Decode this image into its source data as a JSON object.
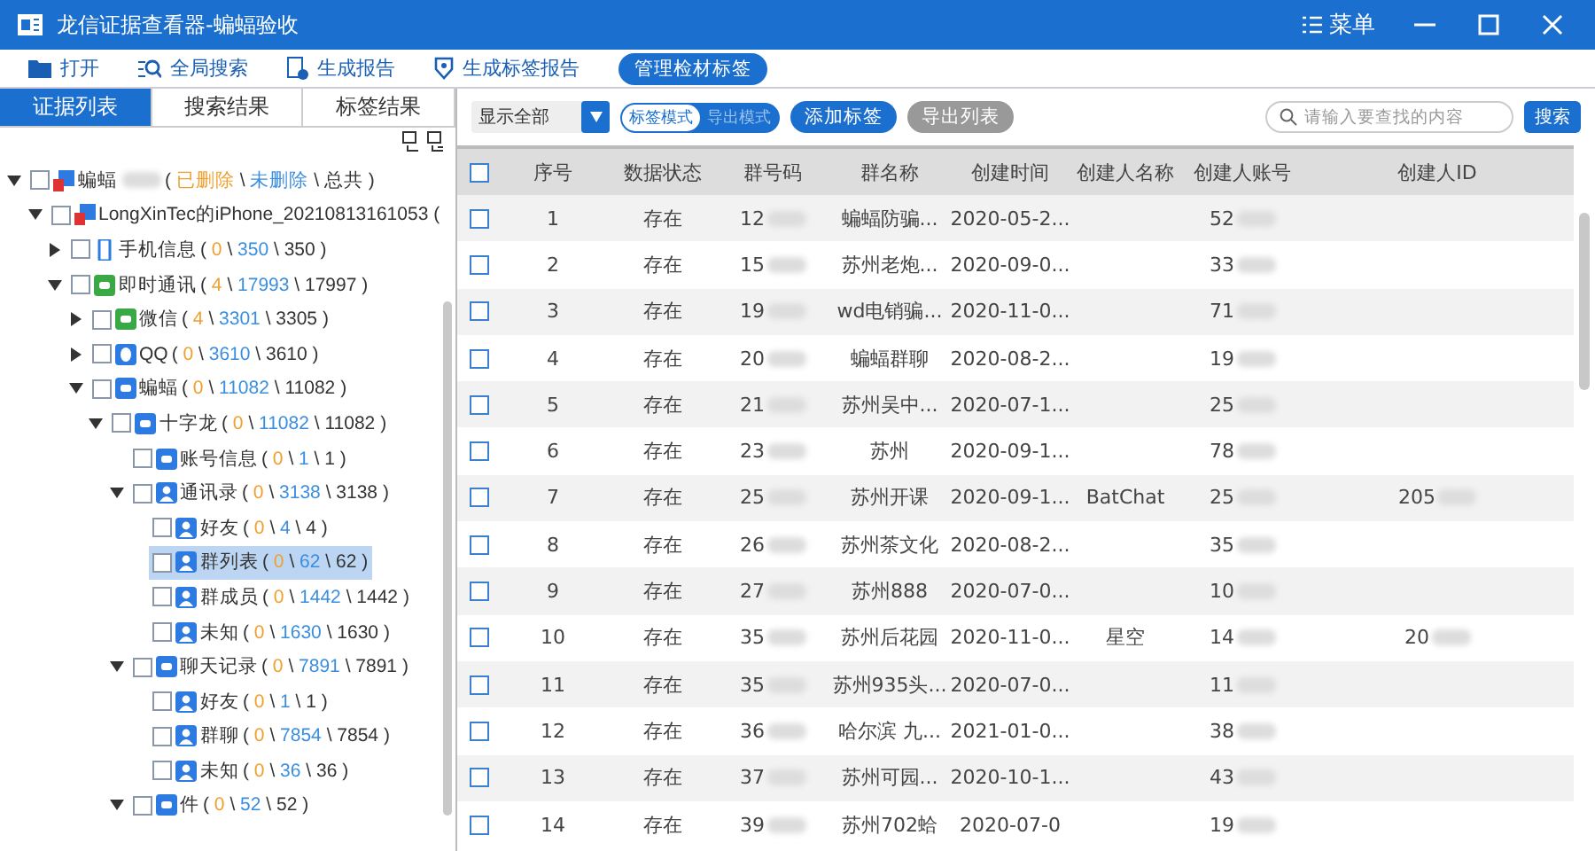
{
  "window": {
    "title": "龙信证据查看器-蝙蝠验收",
    "menu_label": "菜单"
  },
  "toolbar": [
    {
      "label": "打开",
      "kind": "folder"
    },
    {
      "label": "全局搜索",
      "kind": "search"
    },
    {
      "label": "生成报告",
      "kind": "report"
    },
    {
      "label": "生成标签报告",
      "kind": "tag"
    },
    {
      "label": "管理检材标签",
      "kind": "pill"
    }
  ],
  "count_format": {
    "open": "(",
    "sep": "\\",
    "close": ")"
  },
  "left_tabs": [
    {
      "label": "证据列表",
      "selected": true
    },
    {
      "label": "搜索结果",
      "selected": false
    },
    {
      "label": "标签结果",
      "selected": false
    }
  ],
  "tree": [
    {
      "label": "蝙蝠",
      "kind": "device",
      "blurred": true,
      "expanded": true,
      "checked": false,
      "selected": false,
      "deleted": "已删除",
      "undeleted": "未删除",
      "total": "总共",
      "children": [
        {
          "label": "LongXinTec的iPhone_20210813161053 (",
          "kind": "device",
          "expanded": true,
          "checked": false,
          "selected": false,
          "children": [
            {
              "label": "手机信息",
              "kind": "phone",
              "expanded": false,
              "checked": false,
              "selected": false,
              "deleted": "0",
              "undeleted": "350",
              "total": "350"
            },
            {
              "label": "即时通讯",
              "kind": "im",
              "expanded": true,
              "checked": false,
              "selected": false,
              "deleted": "4",
              "undeleted": "17993",
              "total": "17997",
              "children": [
                {
                  "label": "微信",
                  "kind": "wechat",
                  "expanded": false,
                  "checked": false,
                  "selected": false,
                  "deleted": "4",
                  "undeleted": "3301",
                  "total": "3305"
                },
                {
                  "label": "QQ",
                  "kind": "qq",
                  "expanded": false,
                  "checked": false,
                  "selected": false,
                  "deleted": "0",
                  "undeleted": "3610",
                  "total": "3610"
                },
                {
                  "label": "蝙蝠",
                  "kind": "app",
                  "expanded": true,
                  "checked": false,
                  "selected": false,
                  "deleted": "0",
                  "undeleted": "11082",
                  "total": "11082",
                  "children": [
                    {
                      "label": "十字龙",
                      "kind": "app",
                      "expanded": true,
                      "checked": false,
                      "selected": false,
                      "deleted": "0",
                      "undeleted": "11082",
                      "total": "11082",
                      "children": [
                        {
                          "label": "账号信息",
                          "kind": "app",
                          "checked": false,
                          "selected": false,
                          "deleted": "0",
                          "undeleted": "1",
                          "total": "1"
                        },
                        {
                          "label": "通讯录",
                          "kind": "contact",
                          "expanded": true,
                          "checked": false,
                          "selected": false,
                          "deleted": "0",
                          "undeleted": "3138",
                          "total": "3138",
                          "children": [
                            {
                              "label": "好友",
                              "kind": "contact",
                              "checked": false,
                              "selected": false,
                              "deleted": "0",
                              "undeleted": "4",
                              "total": "4"
                            },
                            {
                              "label": "群列表",
                              "kind": "contact",
                              "checked": false,
                              "selected": true,
                              "deleted": "0",
                              "undeleted": "62",
                              "total": "62"
                            },
                            {
                              "label": "群成员",
                              "kind": "contact",
                              "checked": false,
                              "selected": false,
                              "deleted": "0",
                              "undeleted": "1442",
                              "total": "1442"
                            },
                            {
                              "label": "未知",
                              "kind": "contact",
                              "checked": false,
                              "selected": false,
                              "deleted": "0",
                              "undeleted": "1630",
                              "total": "1630"
                            }
                          ]
                        },
                        {
                          "label": "聊天记录",
                          "kind": "chat",
                          "expanded": true,
                          "checked": false,
                          "selected": false,
                          "deleted": "0",
                          "undeleted": "7891",
                          "total": "7891",
                          "children": [
                            {
                              "label": "好友",
                              "kind": "contact",
                              "checked": false,
                              "selected": false,
                              "deleted": "0",
                              "undeleted": "1",
                              "total": "1"
                            },
                            {
                              "label": "群聊",
                              "kind": "contact",
                              "checked": false,
                              "selected": false,
                              "deleted": "0",
                              "undeleted": "7854",
                              "total": "7854"
                            },
                            {
                              "label": "未知",
                              "kind": "contact",
                              "checked": false,
                              "selected": false,
                              "deleted": "0",
                              "undeleted": "36",
                              "total": "36"
                            }
                          ]
                        },
                        {
                          "label": "件",
                          "kind": "chat",
                          "expanded": true,
                          "checked": false,
                          "selected": false,
                          "deleted": "0",
                          "undeleted": "52",
                          "total": "52"
                        }
                      ]
                    }
                  ]
                }
              ]
            }
          ]
        }
      ]
    }
  ],
  "filter": {
    "dropdown": "显示全部",
    "modes": [
      {
        "label": "标签模式",
        "selected": true
      },
      {
        "label": "导出模式",
        "selected": false
      }
    ],
    "add_tag": "添加标签",
    "export_list": "导出列表",
    "search_placeholder": "请输入要查找的内容",
    "search_button": "搜索"
  },
  "table": {
    "header_checked": false,
    "columns": [
      {
        "label": "序号"
      },
      {
        "label": "数据状态"
      },
      {
        "label": "群号码",
        "redacted": true
      },
      {
        "label": "群名称"
      },
      {
        "label": "创建时间"
      },
      {
        "label": "创建人名称"
      },
      {
        "label": "创建人账号",
        "redacted": true
      },
      {
        "label": "创建人ID",
        "redacted": true
      }
    ],
    "rows": [
      {
        "checked": false,
        "cells": [
          "1",
          "存在",
          "12",
          "蝙蝠防骗...",
          "2020-05-2...",
          "",
          "52",
          ""
        ]
      },
      {
        "checked": false,
        "cells": [
          "2",
          "存在",
          "15",
          "苏州老炮...",
          "2020-09-0...",
          "",
          "33",
          ""
        ]
      },
      {
        "checked": false,
        "cells": [
          "3",
          "存在",
          "19",
          "wd电销骗...",
          "2020-11-0...",
          "",
          "71",
          ""
        ]
      },
      {
        "checked": false,
        "cells": [
          "4",
          "存在",
          "20",
          "蝙蝠群聊",
          "2020-08-2...",
          "",
          "19",
          ""
        ]
      },
      {
        "checked": false,
        "cells": [
          "5",
          "存在",
          "21",
          "苏州吴中...",
          "2020-07-1...",
          "",
          "25",
          ""
        ]
      },
      {
        "checked": false,
        "cells": [
          "6",
          "存在",
          "23",
          "苏州",
          "2020-09-1...",
          "",
          "78",
          ""
        ]
      },
      {
        "checked": false,
        "cells": [
          "7",
          "存在",
          "25",
          "苏州开课",
          "2020-09-1...",
          "BatChat",
          "25",
          "205"
        ]
      },
      {
        "checked": false,
        "cells": [
          "8",
          "存在",
          "26",
          "苏州茶文化",
          "2020-08-2...",
          "",
          "35",
          ""
        ]
      },
      {
        "checked": false,
        "cells": [
          "9",
          "存在",
          "27",
          "苏州888",
          "2020-07-0...",
          "",
          "10",
          ""
        ]
      },
      {
        "checked": false,
        "cells": [
          "10",
          "存在",
          "35",
          "苏州后花园",
          "2020-11-0...",
          "星空",
          "14",
          "20"
        ]
      },
      {
        "checked": false,
        "cells": [
          "11",
          "存在",
          "35",
          "苏州935头...",
          "2020-07-0...",
          "",
          "11",
          ""
        ]
      },
      {
        "checked": false,
        "cells": [
          "12",
          "存在",
          "36",
          "哈尔滨 九...",
          "2021-01-0...",
          "",
          "38",
          ""
        ]
      },
      {
        "checked": false,
        "cells": [
          "13",
          "存在",
          "37",
          "苏州可园...",
          "2020-10-1...",
          "",
          "43",
          ""
        ]
      },
      {
        "checked": false,
        "cells": [
          "14",
          "存在",
          "39",
          "苏州702蛤",
          "2020-07-0",
          "",
          "19",
          ""
        ]
      }
    ]
  }
}
